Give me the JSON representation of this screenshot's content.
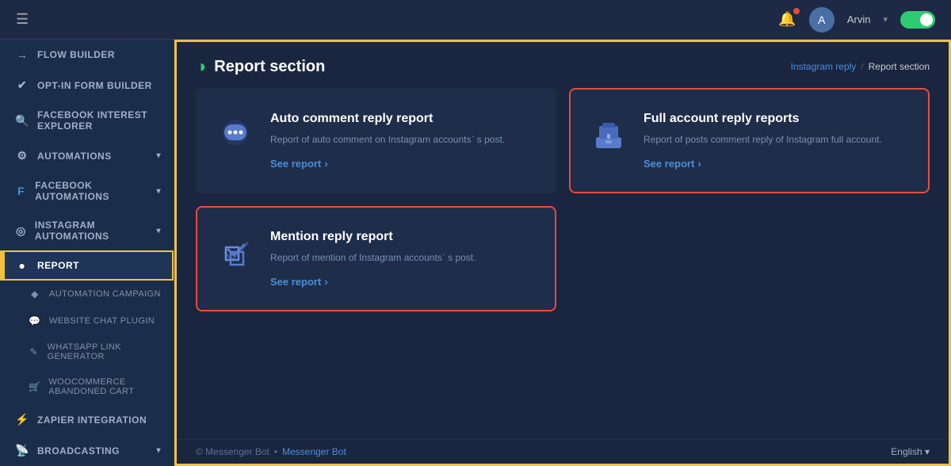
{
  "header": {
    "hamburger": "☰",
    "bell_icon": "🔔",
    "user_name": "Arvin",
    "toggle_state": "on"
  },
  "sidebar": {
    "items": [
      {
        "id": "flow-builder",
        "label": "Flow Builder",
        "icon": "⟶",
        "active": false,
        "has_arrow": false
      },
      {
        "id": "opt-in-form",
        "label": "Opt-In Form Builder",
        "icon": "✔",
        "active": false,
        "has_arrow": false
      },
      {
        "id": "fb-interest",
        "label": "Facebook Interest Explorer",
        "icon": "🔍",
        "active": false,
        "has_arrow": false
      },
      {
        "id": "automations",
        "label": "Automations",
        "icon": "⚙",
        "active": false,
        "has_arrow": true
      },
      {
        "id": "fb-automations",
        "label": "Facebook Automations",
        "icon": "f",
        "active": false,
        "has_arrow": true
      },
      {
        "id": "instagram-automations",
        "label": "Instagram Automations",
        "icon": "◎",
        "active": false,
        "has_arrow": true
      },
      {
        "id": "report",
        "label": "Report",
        "icon": "◑",
        "active": true,
        "has_arrow": false
      },
      {
        "id": "automation-campaign",
        "label": "Automation Campaign",
        "icon": "◆",
        "active": false,
        "has_arrow": false,
        "sub": true
      },
      {
        "id": "website-chat",
        "label": "Website Chat Plugin",
        "icon": "💬",
        "active": false,
        "has_arrow": false,
        "sub": true
      },
      {
        "id": "whatsapp",
        "label": "Whatsapp Link Generator",
        "icon": "✎",
        "active": false,
        "has_arrow": false,
        "sub": true
      },
      {
        "id": "woocommerce",
        "label": "WooCommerce Abandoned Cart",
        "icon": "🛒",
        "active": false,
        "has_arrow": false,
        "sub": true
      },
      {
        "id": "zapier",
        "label": "Zapier Integration",
        "icon": "⚡",
        "active": false,
        "has_arrow": false
      },
      {
        "id": "broadcasting",
        "label": "Broadcasting",
        "icon": "📡",
        "active": false,
        "has_arrow": true
      }
    ]
  },
  "page": {
    "title": "Report section",
    "title_icon": "◑",
    "breadcrumb": {
      "parent": "Instagram reply",
      "separator": "/",
      "current": "Report section"
    }
  },
  "cards": [
    {
      "id": "auto-comment-reply",
      "title": "Auto comment reply report",
      "description": "Report of auto comment on Instagram accounts` s post.",
      "link_label": "See report",
      "icon": "💬",
      "highlighted": false
    },
    {
      "id": "full-account-reply",
      "title": "Full account reply reports",
      "description": "Report of posts comment reply of Instagram full account.",
      "link_label": "See report",
      "icon": "🗂",
      "highlighted": true
    },
    {
      "id": "mention-reply",
      "title": "Mention reply report",
      "description": "Report of mention of Instagram accounts` s post.",
      "link_label": "See report",
      "icon": "🏷",
      "highlighted": true
    }
  ],
  "footer": {
    "copyright": "© Messenger Bot",
    "brand_link": "Messenger Bot",
    "separator": "•",
    "language": "English ▾"
  }
}
